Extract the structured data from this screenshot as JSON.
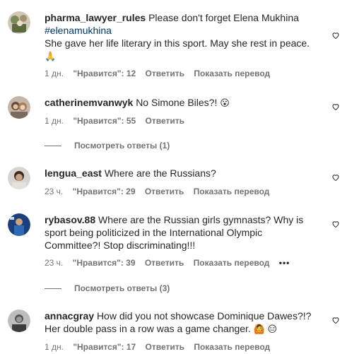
{
  "comments": [
    {
      "username": "pharma_lawyer_rules",
      "text_before": "Please don't forget Elena Mukhina",
      "hashtag": "#elenamukhina",
      "text_after": "She gave her life literary in this sport. May she rest in peace.",
      "emoji": "🙏",
      "time": "1 дн.",
      "likes": "\"Нравится\": 12",
      "reply": "Ответить",
      "translate": "Показать перевод"
    },
    {
      "username": "catherinemvanwyk",
      "text": "No Simone Biles?!",
      "emoji": "😮",
      "time": "1 дн.",
      "likes": "\"Нравится\": 55",
      "reply": "Ответить",
      "view_replies": "Посмотреть ответы (1)"
    },
    {
      "username": "lengua_east",
      "text": "Where are the Russians?",
      "time": "23 ч.",
      "likes": "\"Нравится\": 29",
      "reply": "Ответить",
      "translate": "Показать перевод"
    },
    {
      "username": "rybasov.88",
      "text": "Where are the Russian girls gymnasts? Why is sport being politicized in the International Olympic Committee?! Stop discriminating!!!",
      "time": "23 ч.",
      "likes": "\"Нравится\": 39",
      "reply": "Ответить",
      "translate": "Показать перевод",
      "more": "•••",
      "view_replies": "Посмотреть ответы (3)"
    },
    {
      "username": "annacgray",
      "text": "How did you not showcase Dominique Dawes?!? Her double pass in a row was a game changer.",
      "emoji": "🙆 😑",
      "time": "1 дн.",
      "likes": "\"Нравится\": 17",
      "reply": "Ответить",
      "translate": "Показать перевод"
    }
  ]
}
